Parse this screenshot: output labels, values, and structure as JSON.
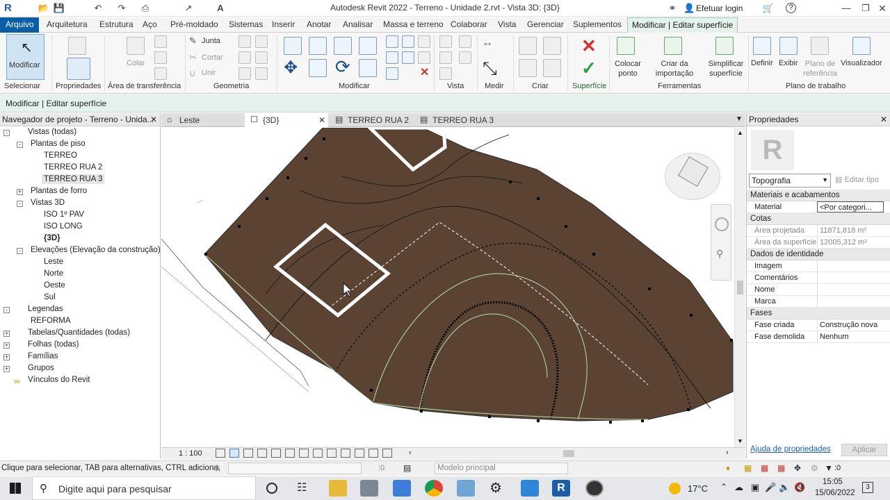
{
  "titlebar": {
    "title": "Autodesk Revit 2022 - Terreno - Unidade 2.rvt - Vista 3D: {3D}",
    "login": "Efetuar login",
    "help": "?"
  },
  "tabs": [
    "Arquivo",
    "Arquitetura",
    "Estrutura",
    "Aço",
    "Pré-moldado",
    "Sistemas",
    "Inserir",
    "Anotar",
    "Analisar",
    "Massa e terreno",
    "Colaborar",
    "Vista",
    "Gerenciar",
    "Suplementos",
    "Modificar | Editar superfície"
  ],
  "ribbon": {
    "modify": "Modificar",
    "select": "Selecionar",
    "properties": "Propriedades",
    "clipboard": "Área de transferência",
    "paste": "Colar",
    "geometry": "Geometria",
    "join": "Junta",
    "cut": "Cortar",
    "unite": "Unir",
    "modify_panel": "Modificar",
    "view_panel": "Vista",
    "measure": "Medir",
    "create": "Criar",
    "surface": "Superfície",
    "tools": "Ferramentas",
    "workplane": "Plano de trabalho",
    "place_point": "Colocar ponto",
    "create_from_import": "Criar da importação",
    "simplify_surface": "Simplificar superfície",
    "define": "Definir",
    "show": "Exibir",
    "ref_plane": "Plano de referência",
    "viewer": "Visualizador"
  },
  "context_label": "Modificar | Editar superfície",
  "browser": {
    "header": "Navegador de projeto - Terreno - Unida...",
    "items": [
      "Vistas (todas)",
      "Plantas de piso",
      "TERREO",
      "TERREO RUA 2",
      "TERREO RUA 3",
      "Plantas de forro",
      "Vistas 3D",
      "ISO 1º PAV",
      "ISO LONG",
      "{3D}",
      "Elevações (Elevação da construção)",
      "Leste",
      "Norte",
      "Oeste",
      "Sul",
      "Legendas",
      "REFORMA",
      "Tabelas/Quantidades (todas)",
      "Folhas (todas)",
      "Famílias",
      "Grupos",
      "Vínculos do Revit"
    ]
  },
  "view_tabs": [
    "Leste",
    "{3D}",
    "TERREO RUA 2",
    "TERREO RUA 3"
  ],
  "scale": "1 : 100",
  "props": {
    "header": "Propriedades",
    "type": "Topografia",
    "edit_type": "Editar tipo",
    "g_materials": "Materiais e acabamentos",
    "material_k": "Material",
    "material_v": "<Por categori...",
    "g_dims": "Cotas",
    "area_proj_k": "Área projetada",
    "area_proj_v": "11871,818 m²",
    "area_surf_k": "Área da superfície",
    "area_surf_v": "12005,312 m²",
    "g_ident": "Dados de identidade",
    "image_k": "Imagem",
    "comments_k": "Comentários",
    "name_k": "Nome",
    "mark_k": "Marca",
    "g_phases": "Fases",
    "phase_created_k": "Fase criada",
    "phase_created_v": "Construção nova",
    "phase_demol_k": "Fase demolida",
    "phase_demol_v": "Nenhum",
    "help": "Ajuda de propriedades",
    "apply": "Aplicar"
  },
  "status": {
    "hint": "Clique para selecionar, TAB para alternativas, CTRL adiciona,",
    "count": ":0",
    "model": "Modelo principal",
    "filter_count": ":0"
  },
  "taskbar": {
    "search": "Digite aqui para pesquisar",
    "temp": "17°C",
    "time": "15:05",
    "date": "15/06/2022",
    "notif": "3"
  },
  "colors": {
    "terrain": "#5a4333",
    "ribbon_active_tab": "#0a5ea8",
    "context_bar": "#e4f2ec"
  }
}
